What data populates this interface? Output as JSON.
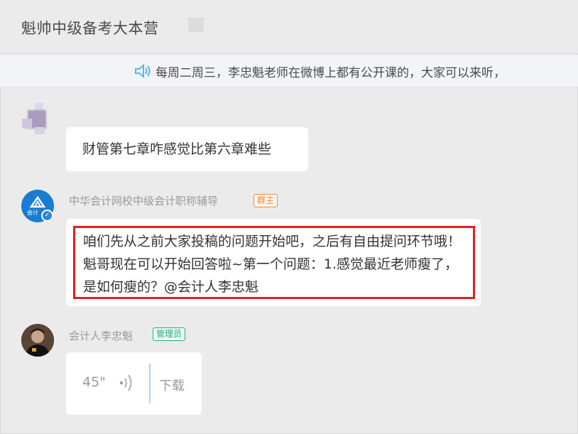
{
  "header": {
    "title": "魁帅中级备考大本营"
  },
  "notice": {
    "icon": "speaker-icon",
    "text": "每周二周三，李忠魁老师在微博上都有公开课的，大家可以来听，"
  },
  "messages": [
    {
      "sender": "",
      "text": "财管第七章咋感觉比第六章难些"
    },
    {
      "sender": "中华会计网校中级会计职称辅导",
      "role": "群主",
      "avatar_text": "会计",
      "text": "咱们先从之前大家投稿的问题开始吧，之后有自由提问环节哦！魁哥现在可以开始回答啦~第一个问题：1.感觉最近老师瘦了，是如何瘦的？@会计人李忠魁"
    },
    {
      "sender": "会计人李忠魁",
      "role": "管理员",
      "voice_duration": "45\"",
      "download_label": "下载"
    }
  ],
  "colors": {
    "owner_badge": "#f08a3c",
    "admin_badge": "#22b07a",
    "highlight": "#e02020",
    "accent": "#1a7cd1"
  }
}
